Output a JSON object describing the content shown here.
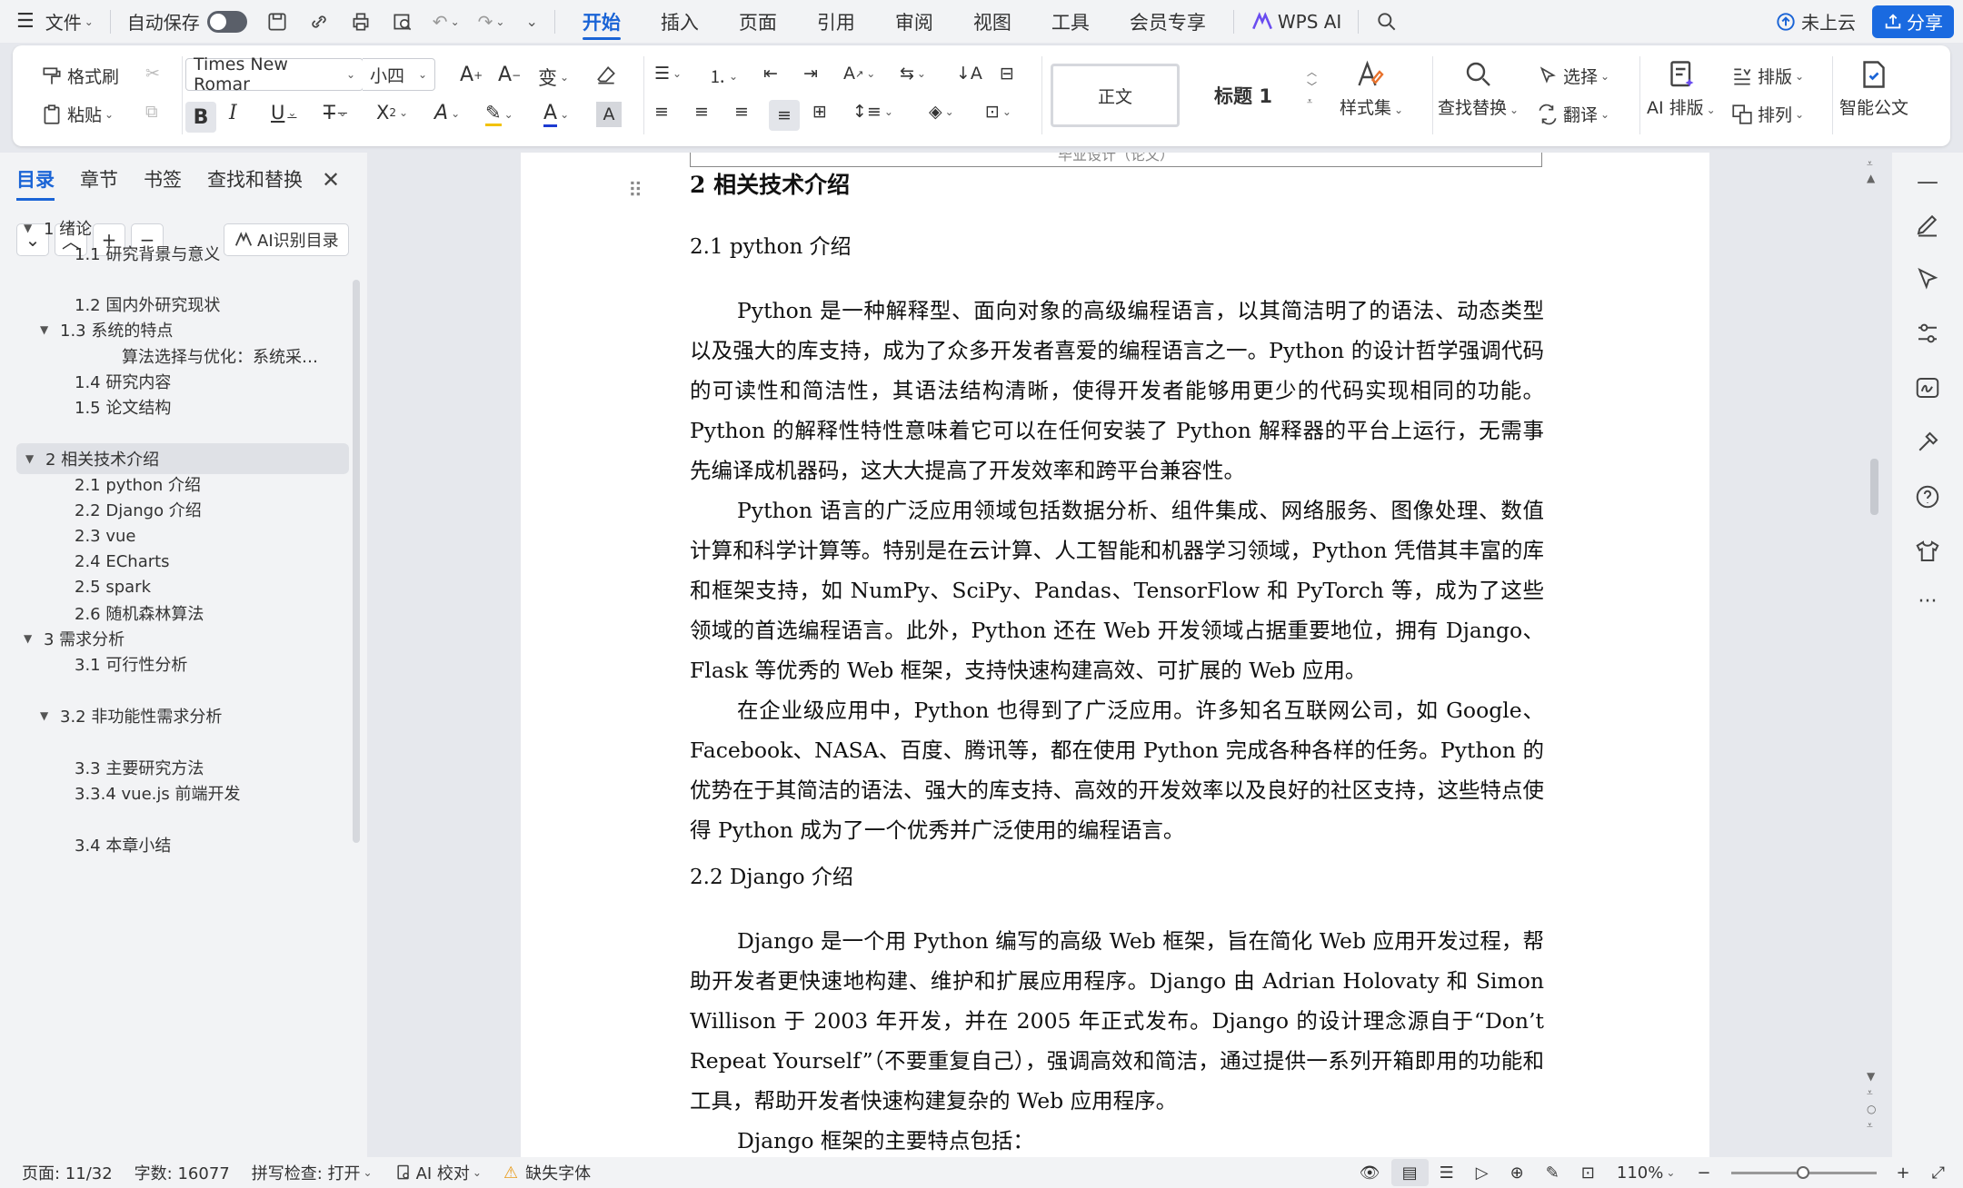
{
  "menubar": {
    "file": "文件",
    "autosave": "自动保存",
    "tabs": [
      "开始",
      "插入",
      "页面",
      "引用",
      "审阅",
      "视图",
      "工具",
      "会员专享"
    ],
    "wps_ai": "WPS AI",
    "cloud": "未上云",
    "share": "分享"
  },
  "ribbon": {
    "format_painter": "格式刷",
    "paste": "粘贴",
    "font_name": "Times New Romar",
    "font_size": "小四",
    "style_normal": "正文",
    "style_heading": "标题 1",
    "style_set": "样式集",
    "find_replace": "查找替换",
    "select": "选择",
    "translate": "翻译",
    "ai_layout": "AI 排版",
    "layout": "排版",
    "arrange": "排列",
    "smart_doc": "智能公文"
  },
  "sidebar": {
    "tabs": [
      "目录",
      "章节",
      "书签",
      "查找和替换"
    ],
    "ai_toc": "AI识别目录",
    "toc": [
      {
        "label": "1  绪论",
        "arrow": "▼"
      },
      {
        "label": "1.1 研究背景与意义",
        "arrow": ""
      },
      {
        "label": "1.2 国内外研究现状",
        "arrow": ""
      },
      {
        "label": "1.3 系统的特点",
        "arrow": "▼"
      },
      {
        "label": "算法选择与优化：系统采…",
        "arrow": ""
      },
      {
        "label": "1.4 研究内容",
        "arrow": ""
      },
      {
        "label": "1.5 论文结构",
        "arrow": ""
      },
      {
        "label": "2  相关技术介绍",
        "arrow": "▼"
      },
      {
        "label": "2.1 python 介绍",
        "arrow": ""
      },
      {
        "label": "2.2 Django  介绍",
        "arrow": ""
      },
      {
        "label": "2.3 vue",
        "arrow": ""
      },
      {
        "label": "2.4 ECharts",
        "arrow": ""
      },
      {
        "label": "2.5 spark",
        "arrow": ""
      },
      {
        "label": "2.6  随机森林算法",
        "arrow": ""
      },
      {
        "label": "3  需求分析",
        "arrow": "▼"
      },
      {
        "label": "3.1 可行性分析",
        "arrow": ""
      },
      {
        "label": "3.2  非功能性需求分析",
        "arrow": "▼"
      },
      {
        "label": "3.3 主要研究方法",
        "arrow": ""
      },
      {
        "label": "3.3.4 vue.js 前端开发",
        "arrow": ""
      },
      {
        "label": "3.4 本章小结",
        "arrow": ""
      }
    ]
  },
  "document": {
    "header_text": "毕业设计（论文）",
    "h1": "2  相关技术介绍",
    "h2_python": "2.1 python  介绍",
    "p1": "Python 是一种解释型、面向对象的高级编程语言，以其简洁明了的语法、动态类型以及强大的库支持，成为了众多开发者喜爱的编程语言之一。Python 的设计哲学强调代码的可读性和简洁性，其语法结构清晰，使得开发者能够用更少的代码实现相同的功能。Python 的解释性特性意味着它可以在任何安装了 Python 解释器的平台上运行，无需事先编译成机器码，这大大提高了开发效率和跨平台兼容性。",
    "p2": "Python 语言的广泛应用领域包括数据分析、组件集成、网络服务、图像处理、数值计算和科学计算等。特别是在云计算、人工智能和机器学习领域，Python 凭借其丰富的库和框架支持，如 NumPy、SciPy、Pandas、TensorFlow 和 PyTorch 等，成为了这些领域的首选编程语言。此外，Python 还在 Web 开发领域占据重要地位，拥有 Django、Flask 等优秀的 Web 框架，支持快速构建高效、可扩展的 Web 应用。",
    "p3": "在企业级应用中，Python 也得到了广泛应用。许多知名互联网公司，如 Google、Facebook、NASA、百度、腾讯等，都在使用 Python 完成各种各样的任务。Python 的优势在于其简洁的语法、强大的库支持、高效的开发效率以及良好的社区支持，这些特点使得 Python 成为了一个优秀并广泛使用的编程语言。",
    "h2_django": "2.2 Django  介绍",
    "p4": "Django 是一个用 Python 编写的高级 Web 框架，旨在简化 Web 应用开发过程，帮助开发者更快速地构建、维护和扩展应用程序。Django 由 Adrian Holovaty 和 Simon Willison 于 2003 年开发，并在 2005 年正式发布。Django 的设计理念源自于“Don’t Repeat Yourself”（不要重复自己），强调高效和简洁，通过提供一系列开箱即用的功能和工具，帮助开发者快速构建复杂的 Web 应用程序。",
    "p5": "Django 框架的主要特点包括："
  },
  "statusbar": {
    "page": "页面: 11/32",
    "words": "字数: 16077",
    "spell": "拼写检查: 打开",
    "ai_check": "AI 校对",
    "missing_font": "缺失字体",
    "zoom": "110%"
  },
  "colors": {
    "accent": "#1a64d6",
    "share": "#1a6ae0"
  }
}
